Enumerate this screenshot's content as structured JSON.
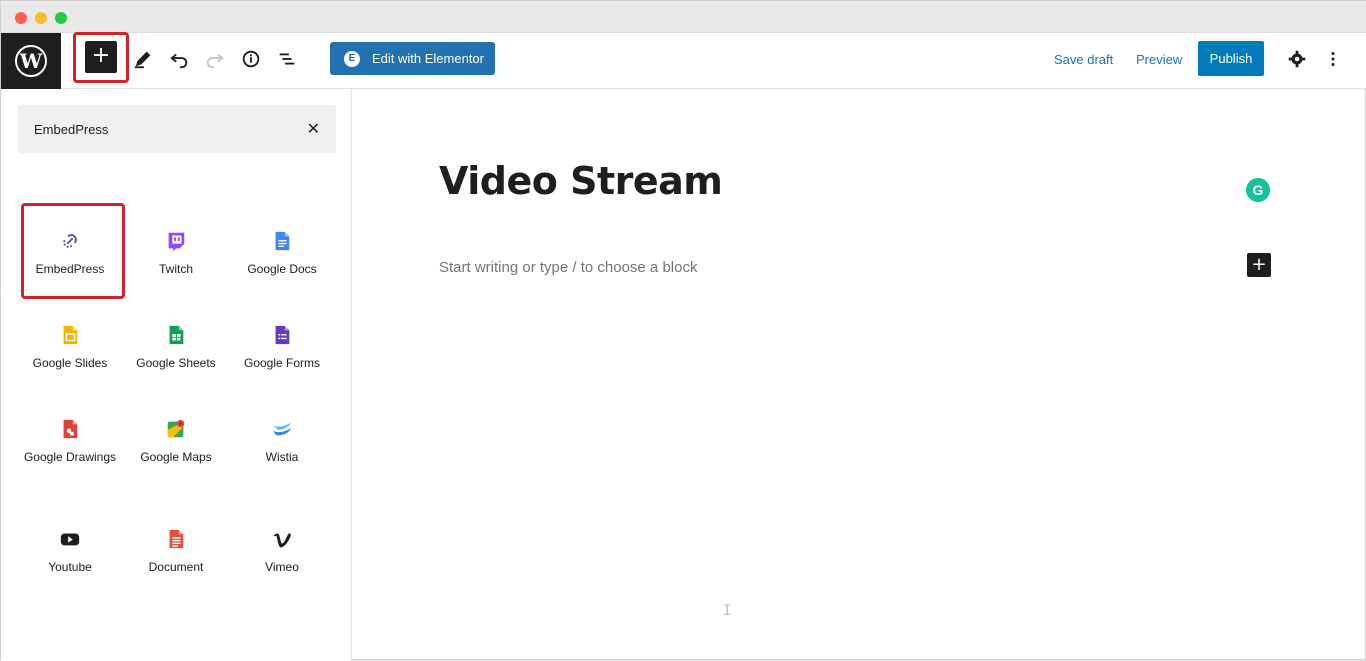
{
  "toolbar": {
    "edit_with_elementor": "Edit with Elementor",
    "save_draft": "Save draft",
    "preview": "Preview",
    "publish": "Publish",
    "add_block_symbol": "+"
  },
  "inserter": {
    "search_value": "EmbedPress",
    "close_symbol": "✕",
    "blocks": [
      {
        "label": "EmbedPress",
        "icon": "embedpress-icon",
        "highlighted": true
      },
      {
        "label": "Twitch",
        "icon": "twitch-icon"
      },
      {
        "label": "Google Docs",
        "icon": "google-docs-icon"
      },
      {
        "label": "Google Slides",
        "icon": "google-slides-icon"
      },
      {
        "label": "Google Sheets",
        "icon": "google-sheets-icon"
      },
      {
        "label": "Google Forms",
        "icon": "google-forms-icon"
      },
      {
        "label": "Google Drawings",
        "icon": "google-drawings-icon"
      },
      {
        "label": "Google Maps",
        "icon": "google-maps-icon"
      },
      {
        "label": "Wistia",
        "icon": "wistia-icon"
      },
      {
        "label": "Youtube",
        "icon": "youtube-icon"
      },
      {
        "label": "Document",
        "icon": "document-icon"
      },
      {
        "label": "Vimeo",
        "icon": "vimeo-icon"
      }
    ]
  },
  "editor": {
    "title": "Video Stream",
    "placeholder": "Start writing or type / to choose a block",
    "inline_add_symbol": "+",
    "grammarly_letter": "G"
  },
  "colors": {
    "accent": "#2271b1",
    "publish": "#007cba",
    "highlight": "#d6212a",
    "grammarly": "#15c39a"
  }
}
